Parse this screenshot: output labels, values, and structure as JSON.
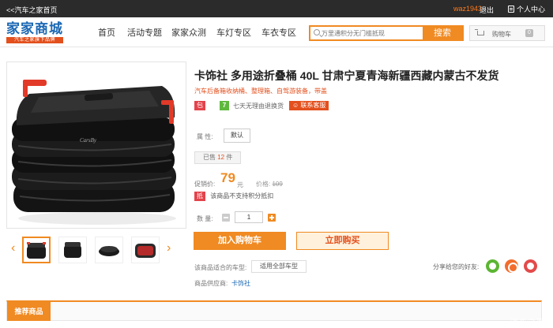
{
  "topbar": {
    "home_link": "<<汽车之家首页",
    "username": "waz1943",
    "logout": "退出",
    "user_center": "个人中心"
  },
  "header": {
    "logo_main": "家家商城",
    "logo_sub": "汽车之家旗下品牌",
    "nav": [
      "首页",
      "活动专题",
      "家家众测",
      "车灯专区",
      "车衣专区"
    ],
    "search_placeholder": "万里通积分无门槛抵现",
    "search_button": "搜索",
    "cart_label": "购物车",
    "cart_count": "0"
  },
  "product": {
    "title": "卡饰社 多用途折叠桶 40L 甘肃宁夏青海新疆西藏内蒙古不发货",
    "subtitle": "汽车后备箱收纳桶、整理箱、自驾游装备，带盖",
    "badge_shipping": "包邮",
    "badge_seven": "7",
    "return_text": "七天无理由退换货",
    "service_button": "联系客服",
    "attr_label": "属 性:",
    "attr_option": "默认",
    "sold_label": "已售",
    "sold_count": "12",
    "sold_unit": "件",
    "price_label": "促销价:",
    "price": "79",
    "price_unit": "元",
    "old_price_label": "价格:",
    "old_price": "109",
    "points_tag": "抵",
    "points_text": "该商品不支持积分抵扣",
    "qty_label": "数 量:",
    "qty_value": "1",
    "add_cart": "加入购物车",
    "buy_now": "立即购买",
    "fit_label": "该商品适合的车型:",
    "fit_button": "适用全部车型",
    "supplier_label": "商品供应商:",
    "supplier": "卡饰社",
    "brand_on_product": "CarsBy"
  },
  "share": {
    "label": "分享给您的好友:",
    "icons": [
      "wechat-icon",
      "qq-icon",
      "weibo-icon"
    ]
  },
  "recommend": {
    "tab": "推荐商品"
  },
  "watermark": "汽车之家",
  "colors": {
    "accent": "#f08a22",
    "red": "#e3501d",
    "brand_blue": "#1a67b3"
  }
}
